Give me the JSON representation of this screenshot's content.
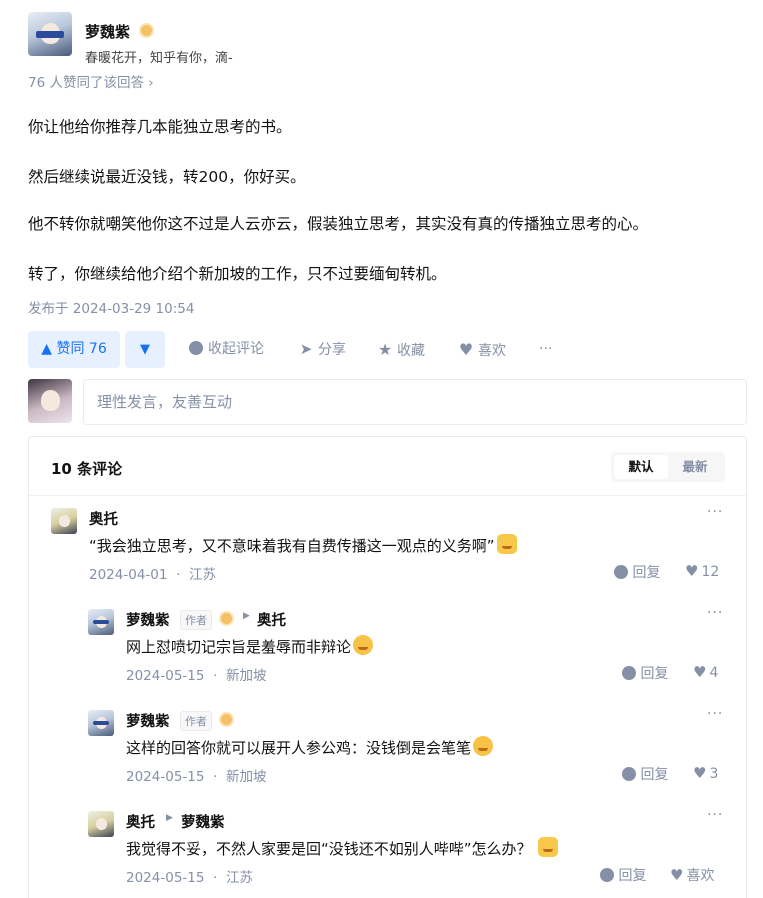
{
  "author": {
    "name": "萝魏紫",
    "bio": "春暖花开，知乎有你，滴-"
  },
  "voters_text": "76 人赞同了该回答 ›",
  "answer": {
    "paragraphs": [
      "你让他给你推荐几本能独立思考的书。",
      "然后继续说最近没钱，转200，你好买。",
      "他不转你就嘲笑他你这不过是人云亦云，假装独立思考，其实没有真的传播独立思考的心。",
      "转了，你继续给他介绍个新加坡的工作，只不过要缅甸转机。"
    ],
    "published": "发布于 2024-03-29 10:54"
  },
  "actions": {
    "upvote": "▲ 赞同 76",
    "downvote": "▼",
    "collapse_comments": "收起评论",
    "share": "分享",
    "favorite": "收藏",
    "like": "喜欢",
    "more": "···"
  },
  "comment_input": {
    "placeholder": "理性发言，友善互动"
  },
  "comments_panel": {
    "title": "10 条评论",
    "sort_default": "默认",
    "sort_latest": "最新"
  },
  "comments": [
    {
      "name": "奥托",
      "text": "“我会独立思考，又不意味着我有自费传播这一观点的义务啊”",
      "date": "2024-04-01",
      "location": "江苏",
      "reply_label": "回复",
      "likes": "12",
      "more": "···"
    },
    {
      "name": "萝魏紫",
      "tag": "作者",
      "reply_to": "奥托",
      "text": "网上怼喷切记宗旨是羞辱而非辩论",
      "date": "2024-05-15",
      "location": "新加坡",
      "reply_label": "回复",
      "likes": "4",
      "more": "···"
    },
    {
      "name": "萝魏紫",
      "tag": "作者",
      "text": "这样的回答你就可以展开人参公鸡：没钱倒是会笔笔",
      "date": "2024-05-15",
      "location": "新加坡",
      "reply_label": "回复",
      "likes": "3",
      "more": "···"
    },
    {
      "name": "奥托",
      "reply_to": "萝魏紫",
      "text": "我觉得不妥，不然人家要是回“没钱还不如别人哔哔”怎么办？",
      "date": "2024-05-15",
      "location": "江苏",
      "reply_label": "回复",
      "likes": "喜欢",
      "more": "···"
    }
  ],
  "meta_separator": "·",
  "colors": {
    "accent": "#1772f6",
    "accent_bg": "#e7f0ff",
    "muted": "#8590a6"
  }
}
